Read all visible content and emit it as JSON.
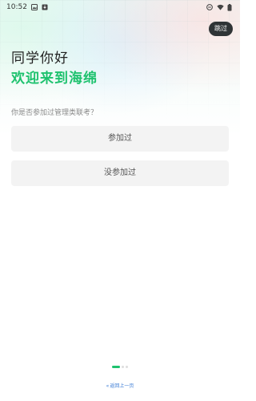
{
  "status_bar": {
    "time": "10:52",
    "left_icons": [
      "image-icon",
      "download-app-icon"
    ],
    "right_icons": [
      "dnd-icon",
      "wifi-icon",
      "battery-icon"
    ]
  },
  "header": {
    "skip_label": "跳过",
    "greeting": "同学你好",
    "welcome": "欢迎来到海绵"
  },
  "question": {
    "text": "你是否参加过管理类联考？",
    "options": [
      {
        "label": "参加过"
      },
      {
        "label": "没参加过"
      }
    ]
  },
  "pagination": {
    "total": 3,
    "current": 1
  },
  "footer": {
    "back_label": "返回上一页"
  },
  "colors": {
    "accent": "#1ec26e",
    "skip_bg": "#2f3436",
    "option_bg": "#f3f3f3",
    "link": "#3a7bd5"
  }
}
